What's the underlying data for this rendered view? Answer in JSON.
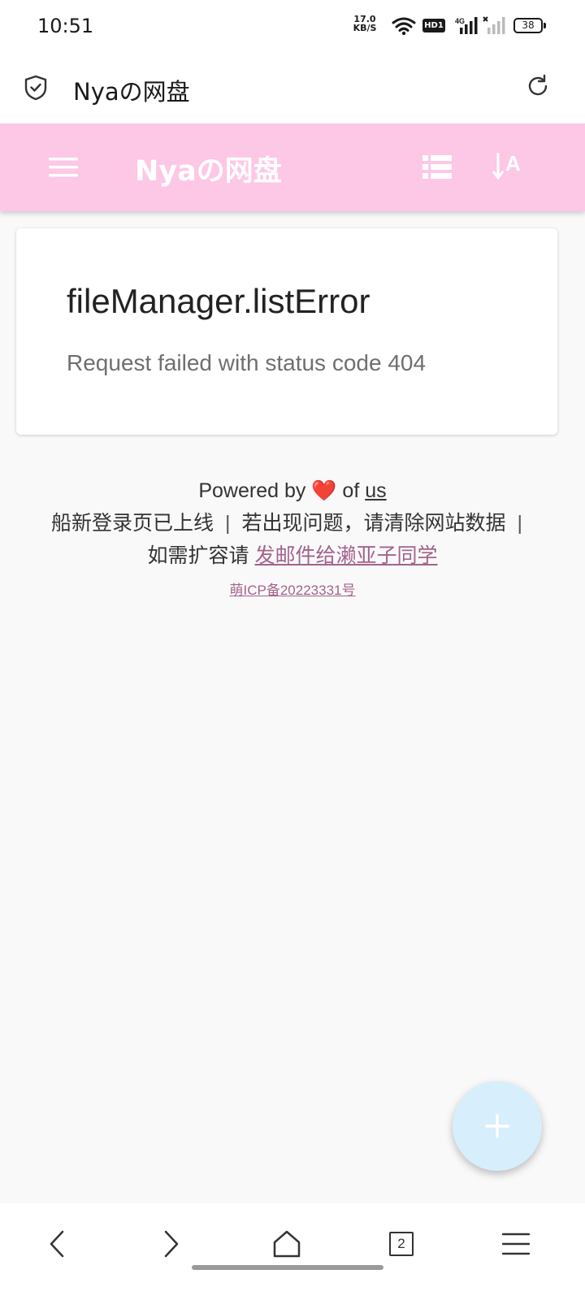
{
  "status_bar": {
    "time": "10:51",
    "net_speed_value": "17.0",
    "net_speed_unit": "KB/S",
    "hd_label": "HD1",
    "network_type": "4G",
    "battery": "38",
    "icons": [
      "wifi-icon",
      "hd-icon",
      "signal-4g-icon",
      "signal-no-sim-icon",
      "battery-icon"
    ]
  },
  "browser": {
    "title": "Nyaの网盘",
    "icons": [
      "shield-check-icon",
      "refresh-icon"
    ]
  },
  "app_bar": {
    "title": "Nyaの网盘",
    "color": "#fdc7e6",
    "sort_glyph": "A",
    "icons": [
      "menu-icon",
      "list-view-icon",
      "sort-icon"
    ]
  },
  "error": {
    "title": "fileManager.listError",
    "message": "Request failed with status code 404"
  },
  "footer": {
    "powered_prefix": "Powered by",
    "heart": "❤️",
    "powered_mid": "of",
    "powered_link": "us",
    "notice_1": "船新登录页已上线",
    "sep_1": "|",
    "notice_2": "若出现问题，请清除网站数据",
    "sep_2": "|",
    "expand_prefix": "如需扩容请",
    "expand_link": "发邮件给濑亚子同学",
    "icp": "萌ICP备20223331号",
    "link_color": "#a3638b"
  },
  "fab": {
    "icon": "plus-icon",
    "color": "#d7eefc"
  },
  "bottom_nav": {
    "tab_count": "2",
    "icons": [
      "back-icon",
      "forward-icon",
      "home-icon",
      "tabs-icon",
      "menu-icon"
    ]
  }
}
